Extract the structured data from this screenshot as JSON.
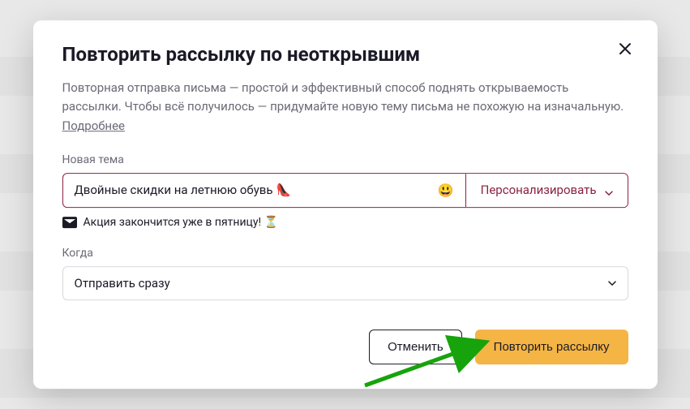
{
  "modal": {
    "title": "Повторить рассылку по неоткрывшим",
    "description": "Повторная отправка письма — простой и эффективный способ поднять открываемость рассылки. Чтобы всё получилось — придумайте новую тему письма не похожую на изначальную.  ",
    "more_link": "Подробнее",
    "subject_label": "Новая тема",
    "subject_value": "Двойные скидки на летнюю обувь 👠",
    "subject_emoji": "😃",
    "personalize_label": "Персонализировать",
    "helper": "Акция закончится уже в пятницу! ⏳",
    "when_label": "Когда",
    "when_value": "Отправить сразу",
    "cancel": "Отменить",
    "submit": "Повторить рассылку"
  }
}
